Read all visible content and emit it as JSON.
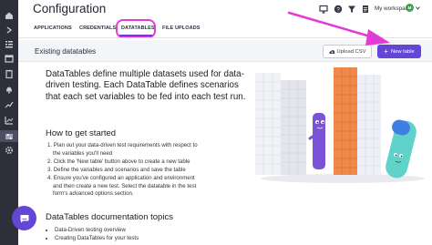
{
  "header": {
    "title": "Configuration",
    "workspace_label": "My workspace",
    "avatar_initial": "M"
  },
  "tabs": [
    {
      "label": "APPLICATIONS"
    },
    {
      "label": "CREDENTIALS"
    },
    {
      "label": "DATATABLES",
      "active": true
    },
    {
      "label": "FILE UPLOADS"
    }
  ],
  "content": {
    "section_title": "Existing datatables",
    "upload_label": "Upload CSV",
    "new_label": "New table",
    "intro": "DataTables define multiple datasets used for data-driven testing. Each DataTable defines scenarios that each set variables to be fed into each test run.",
    "getting_started_title": "How to get started",
    "steps": [
      "1. Plan out your data-driven test requirements with respect to",
      "    the variables you'll need",
      "2. Click the 'New table' button above to create a new table",
      "3. Define the variables and scenarios and save the table",
      "4. Ensure you've configured an application and environment",
      "    and then create a new test. Select the datatable in the test",
      "    form's advanced options section."
    ],
    "docs_title": "DataTables documentation topics",
    "docs": [
      "Data-Driven testing overview",
      "Creating DataTables for your tests"
    ]
  },
  "colors": {
    "accent": "#6446d6",
    "annotation": "#e23bd6",
    "sidebar": "#2d2f3a"
  }
}
